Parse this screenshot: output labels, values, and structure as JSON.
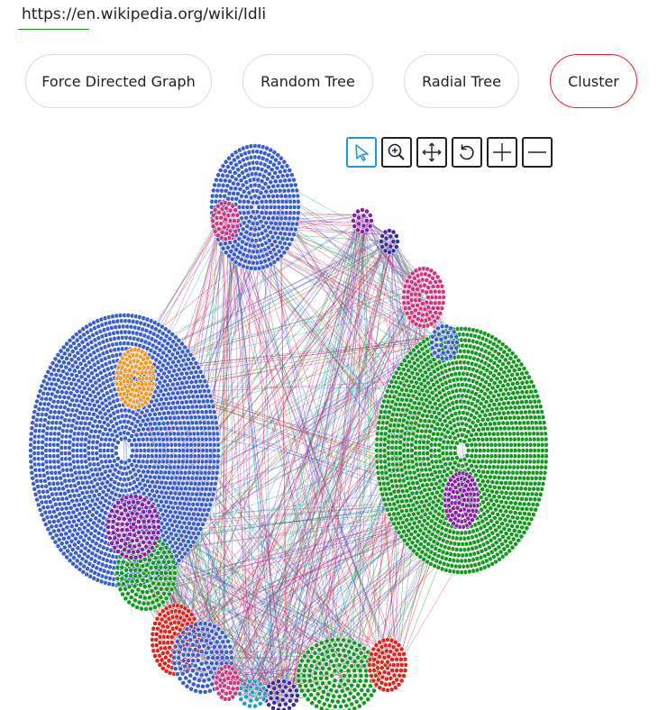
{
  "address_bar": {
    "url": "https://en.wikipedia.org/wiki/Idli"
  },
  "modes": [
    {
      "label": "Force Directed Graph",
      "active": false
    },
    {
      "label": "Random Tree",
      "active": false
    },
    {
      "label": "Radial Tree",
      "active": false
    },
    {
      "label": "Cluster",
      "active": true
    }
  ],
  "toolbar": [
    {
      "icon": "select-arrow-icon",
      "active": true
    },
    {
      "icon": "zoom-in-icon",
      "active": false
    },
    {
      "icon": "pan-move-icon",
      "active": false
    },
    {
      "icon": "reset-rotate-icon",
      "active": false
    },
    {
      "icon": "plus-icon",
      "active": false
    },
    {
      "icon": "minus-icon",
      "active": false
    }
  ],
  "colors": {
    "accent_active_mode": "#e0262b",
    "accent_active_tool": "#1c9bd1",
    "url_underline": "#2a8a2a",
    "node_blue": "#3a5fcd",
    "node_green": "#139a1e",
    "node_red": "#e0241c",
    "node_magenta": "#d6337a",
    "node_purple": "#8a1fa6",
    "node_orange": "#f39a1e",
    "node_cyan": "#1b9ec9",
    "node_navy": "#3b2aa0"
  }
}
